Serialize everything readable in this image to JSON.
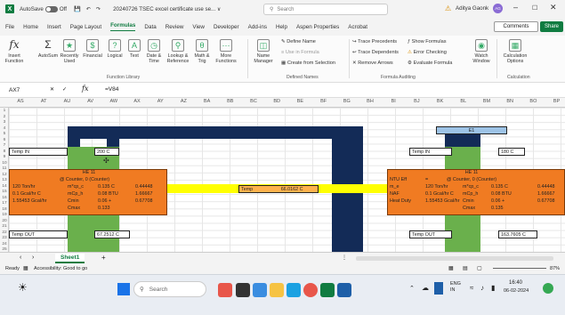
{
  "titlebar": {
    "autosave": "AutoSave",
    "toggle_state": "Off",
    "filename": "20240726 TSEC excel certificate use se... ∨",
    "search": "Search",
    "user": "Aditya Gaonk",
    "user_initials": "AG"
  },
  "menu": [
    "File",
    "Home",
    "Insert",
    "Page Layout",
    "Formulas",
    "Data",
    "Review",
    "View",
    "Developer",
    "Add-ins",
    "Help",
    "Aspen Properties",
    "Acrobat"
  ],
  "menu_active": "Formulas",
  "actions": {
    "comments": "Comments",
    "share": "Share"
  },
  "ribbon": {
    "insert_function": "Insert\nFunction",
    "autosum": "AutoSum",
    "recent": "Recently\nUsed",
    "financial": "Financial",
    "logical": "Logical",
    "text": "Text",
    "datetime": "Date &\nTime",
    "lookup": "Lookup &\nReference",
    "math": "Math &\nTrig",
    "more": "More\nFunctions",
    "library_title": "Function Library",
    "name_manager": "Name\nManager",
    "define_name": "Define Name",
    "use_in_formula": "Use in Formula",
    "create_from_selection": "Create from Selection",
    "defined_names_title": "Defined Names",
    "trace_precedents": "Trace Precedents",
    "trace_dependents": "Trace Dependents",
    "remove_arrows": "Remove Arrows",
    "show_formulas": "Show Formulas",
    "error_checking": "Error Checking",
    "evaluate_formula": "Evaluate Formula",
    "auditing_title": "Formula Auditing",
    "watch_window": "Watch\nWindow",
    "calc_options": "Calculation\nOptions",
    "calc_title": "Calculation"
  },
  "formula_bar": {
    "cell_ref": "AX7",
    "formula": "=V84"
  },
  "columns": [
    "AS",
    "AT",
    "AU",
    "AV",
    "AW",
    "AX",
    "AY",
    "AZ",
    "BA",
    "BB",
    "BC",
    "BD",
    "BE",
    "BF",
    "BG",
    "BH",
    "BI",
    "BJ",
    "BK",
    "BL",
    "BM",
    "BN",
    "BO",
    "BP"
  ],
  "rows": [
    "1",
    "2",
    "3",
    "4",
    "5",
    "6",
    "7",
    "8",
    "9",
    "10",
    "11",
    "12",
    "13",
    "14",
    "15",
    "16",
    "17",
    "18",
    "19",
    "20",
    "21",
    "22",
    "23",
    "24",
    "25"
  ],
  "sheet": {
    "left_temp_in_label": "Temp IN",
    "left_temp_in_value": "200 C",
    "left_hx_title": "HE 11",
    "left_hx_subtitle": "@ Counter, 0 (Counter)",
    "left_hx_rows": [
      [
        "120 Ton/hr",
        "m*cp_c",
        "0.135 C",
        "0.44448"
      ],
      [
        "0.1 Gcal/hr C",
        "mCp_h",
        "0.08 BTU",
        "1.66667"
      ],
      [
        "1.55453 Gcal/hr",
        "Cmin",
        "0.06 +",
        "0.67708"
      ],
      [
        "",
        "Cmax",
        "0.133",
        ""
      ]
    ],
    "left_temp_out_label": "Temp OUT",
    "left_temp_out_value": "67.2512 C",
    "middle_label": "Temp",
    "middle_value": "66.0162 C",
    "right_top_label": "E1",
    "right_temp_in_label": "Temp IN",
    "right_temp_in_value": "180 C",
    "right_hx_title": "HE 11",
    "right_hx_subtitle": "@ Counter, 0 (Counter)",
    "right_hx_rows": [
      [
        "NTU Eff",
        "=",
        "",
        ""
      ],
      [
        "m_e",
        "120 Ton/hr",
        "m*cp_c",
        "0.135 C",
        "0.44448"
      ],
      [
        "NAF",
        "0.1 Gcal/hr C",
        "mCp_h",
        "0.08 BTU",
        "1.66667"
      ],
      [
        "Heat Duty",
        "1.55453 Gcal/hr",
        "Cmin",
        "0.06 +",
        "0.67708"
      ],
      [
        "",
        "",
        "Cmax",
        "0.135",
        ""
      ]
    ],
    "right_temp_out_label": "Temp OUT",
    "right_temp_out_value": "163.7605 C"
  },
  "sheet_tab": "Sheet1",
  "status": {
    "ready": "Ready",
    "accessibility": "Accessibility: Good to go",
    "zoom": "87%"
  },
  "taskbar": {
    "search": "Search",
    "lang": "ENG\nIN",
    "time": "16:40",
    "date": "06-02-2024"
  },
  "colors": {
    "excel_green": "#107c41",
    "navy": "#132b57",
    "cell_green": "#6ab04c",
    "cell_orange": "#f07b22",
    "yellow": "#ffff00"
  }
}
